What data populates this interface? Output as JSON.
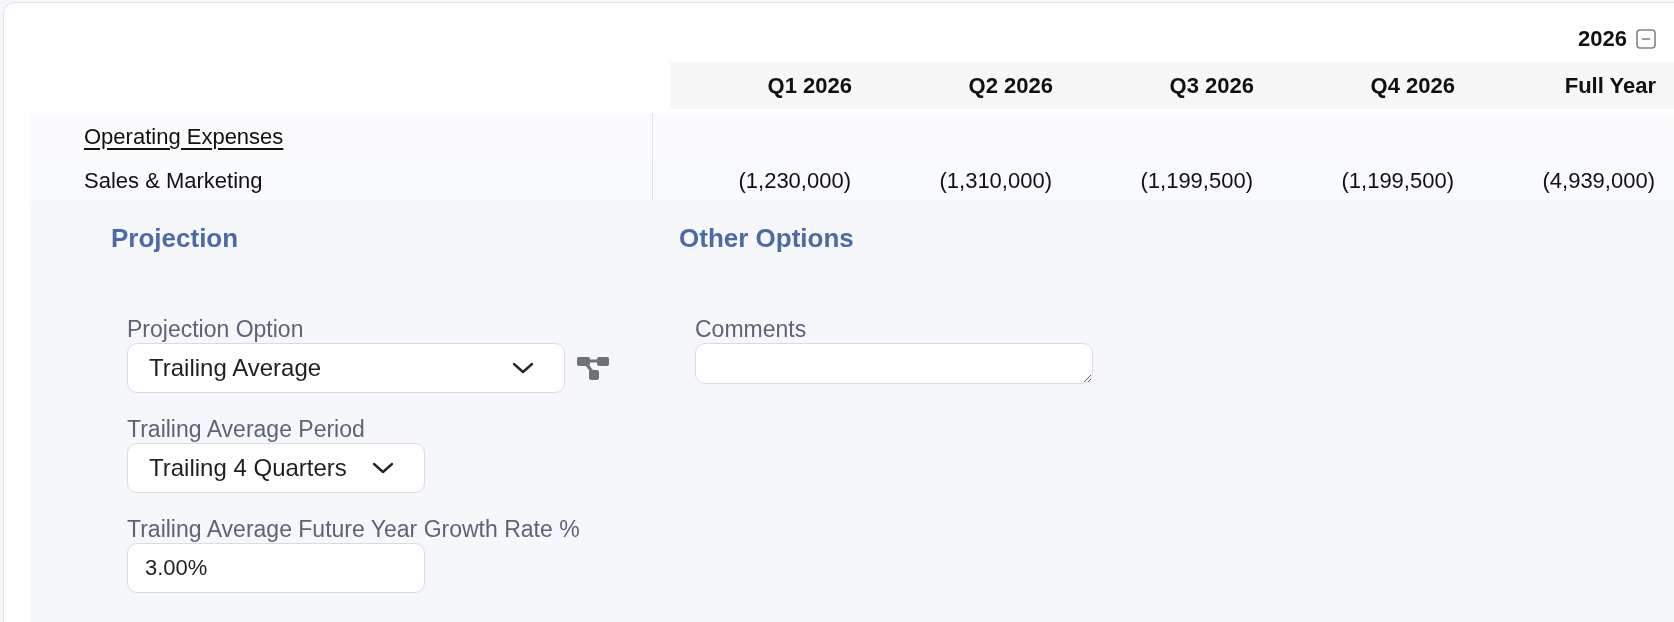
{
  "year_header": {
    "label": "2026",
    "expanded": true
  },
  "table": {
    "columns": [
      "Q1 2026",
      "Q2 2026",
      "Q3 2026",
      "Q4 2026",
      "Full Year"
    ],
    "rows": [
      {
        "kind": "group",
        "label": "Operating Expenses"
      },
      {
        "kind": "item",
        "label": "Sales & Marketing",
        "values": [
          "(1,230,000)",
          "(1,310,000)",
          "(1,199,500)",
          "(1,199,500)",
          "(4,939,000)"
        ]
      }
    ]
  },
  "projection": {
    "title": "Projection",
    "option": {
      "label": "Projection Option",
      "value": "Trailing Average"
    },
    "period": {
      "label": "Trailing Average Period",
      "value": "Trailing 4 Quarters"
    },
    "growth_rate": {
      "label": "Trailing Average Future Year Growth Rate %",
      "value": "3.00%"
    }
  },
  "other_options": {
    "title": "Other Options",
    "comments": {
      "label": "Comments"
    }
  }
}
